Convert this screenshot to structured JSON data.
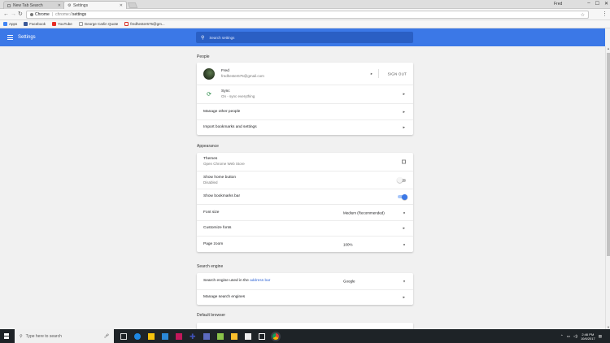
{
  "tabs": [
    {
      "label": "New Tab Search",
      "active": false
    },
    {
      "label": "Settings",
      "active": true
    }
  ],
  "window": {
    "profile_name": "Fred"
  },
  "omnibox": {
    "site": "Chrome",
    "scheme": "chrome://",
    "path": "settings"
  },
  "bookmarks": [
    {
      "label": "Apps",
      "icon": "apps-grid-icon",
      "color": "#4285f4"
    },
    {
      "label": "Facebook",
      "icon": "facebook-icon",
      "color": "#3b5998"
    },
    {
      "label": "YouTube",
      "icon": "youtube-icon",
      "color": "#e52d27"
    },
    {
      "label": "George Carlin Quote",
      "icon": "page-icon",
      "color": "#9e9e9e"
    },
    {
      "label": "fredhester675@gm...",
      "icon": "gmail-icon",
      "color": "#d93025"
    }
  ],
  "header": {
    "title": "Settings",
    "search_placeholder": "Search settings",
    "color": "#3b78e7"
  },
  "sections": {
    "people": {
      "title": "People",
      "profile_name": "Fred",
      "profile_email": "fredhester675@gmail.com",
      "signout_label": "SIGN OUT",
      "sync_label": "Sync",
      "sync_status": "On - sync everything",
      "manage_people": "Manage other people",
      "import_label": "Import bookmarks and settings"
    },
    "appearance": {
      "title": "Appearance",
      "themes_label": "Themes",
      "themes_sub": "Open Chrome Web Store",
      "home_label": "Show home button",
      "home_sub": "Disabled",
      "home_on": false,
      "bookmarks_bar_label": "Show bookmarks bar",
      "bookmarks_bar_on": true,
      "font_size_label": "Font size",
      "font_size_value": "Medium (Recommended)",
      "customize_fonts": "Customize fonts",
      "page_zoom_label": "Page zoom",
      "page_zoom_value": "100%"
    },
    "search_engine": {
      "title": "Search engine",
      "used_prefix": "Search engine used in the ",
      "used_link": "address bar",
      "engine_value": "Google",
      "manage_label": "Manage search engines"
    },
    "default_browser": {
      "title": "Default browser"
    }
  },
  "taskbar": {
    "search_placeholder": "Type here to search",
    "time": "2:46 PM",
    "date": "10/6/2017"
  }
}
